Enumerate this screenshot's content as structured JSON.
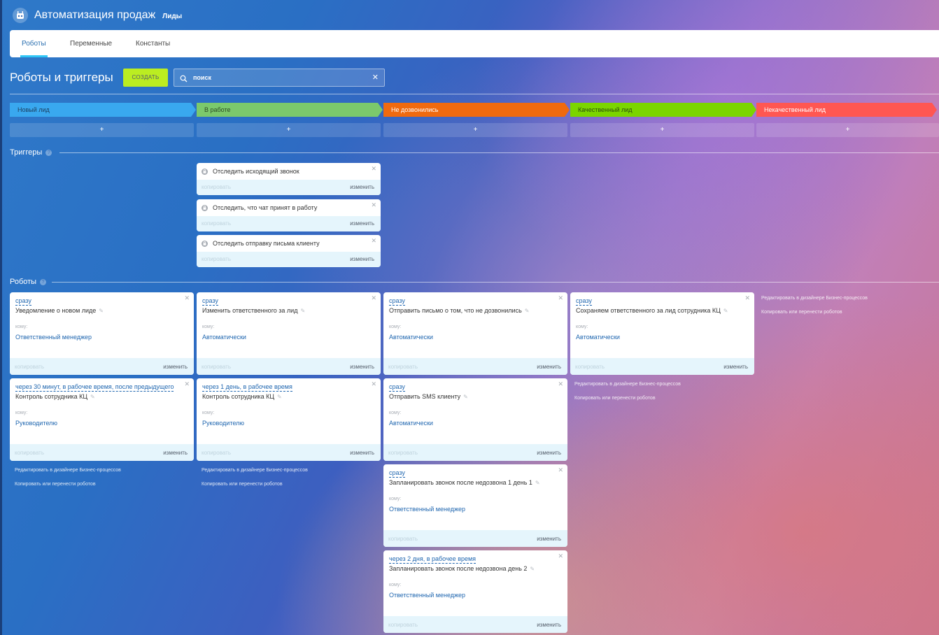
{
  "app": {
    "title": "Автоматизация продаж",
    "subtitle": "Лиды",
    "icon": "robot-icon"
  },
  "tabs": [
    {
      "label": "Роботы",
      "active": true
    },
    {
      "label": "Переменные",
      "active": false
    },
    {
      "label": "Константы",
      "active": false
    }
  ],
  "header": {
    "title": "Роботы и триггеры",
    "create_label": "СОЗДАТЬ"
  },
  "search": {
    "value": "поиск"
  },
  "stages": [
    {
      "name": "Новый лид",
      "color": "#39a8ef",
      "text_color": "#1d3d5e"
    },
    {
      "name": "В работе",
      "color": "#7bc96c",
      "text_color": "#2b4a23"
    },
    {
      "name": "Не дозвонились",
      "color": "#f06a0f",
      "text_color": "#ffffff"
    },
    {
      "name": "Качественный лид",
      "color": "#7bd500",
      "text_color": "#2b4a10"
    },
    {
      "name": "Некачественный лид",
      "color": "#ff5752",
      "text_color": "#ffffff"
    }
  ],
  "add_symbol": "+",
  "triggers_title": "Триггеры",
  "robots_title": "Роботы",
  "triggers": [
    {
      "name": "Отследить исходящий звонок"
    },
    {
      "name": "Отследить, что чат принят в работу"
    },
    {
      "name": "Отследить отправку письма клиенту"
    }
  ],
  "card_actions": {
    "copy": "копировать",
    "edit": "изменить"
  },
  "to_label": "кому:",
  "robots": {
    "col0": [
      {
        "when": "сразу",
        "name": "Уведомление о новом лиде",
        "to": "Ответственный менеджер"
      },
      {
        "when": "через 30 минут, в рабочее время, после предыдущего",
        "name": "Контроль сотрудника КЦ",
        "to": "Руководителю"
      }
    ],
    "col1": [
      {
        "when": "сразу",
        "name": "Изменить ответственного за лид",
        "to": "Автоматически"
      },
      {
        "when": "через 1 день, в рабочее время",
        "name": "Контроль сотрудника КЦ",
        "to": "Руководителю"
      }
    ],
    "col2": [
      {
        "when": "сразу",
        "name": "Отправить письмо о том, что не дозвонились",
        "to": "Автоматически"
      },
      {
        "when": "сразу",
        "name": "Отправить SMS клиенту",
        "to": "Автоматически"
      },
      {
        "when": "сразу",
        "name": "Запланировать звонок после недозвона 1 день 1",
        "to": "Ответственный менеджер"
      },
      {
        "when": "через 2 дня, в рабочее время",
        "name": "Запланировать звонок после недозвона день 2",
        "to": "Ответственный менеджер"
      }
    ],
    "col3": [
      {
        "when": "сразу",
        "name": "Сохраняем ответственного за лид сотрудника КЦ",
        "to": "Автоматически"
      }
    ]
  },
  "column_links": {
    "designer": "Редактировать в дизайнере Бизнес-процессов",
    "copy_move": "Копировать или перенести роботов"
  }
}
